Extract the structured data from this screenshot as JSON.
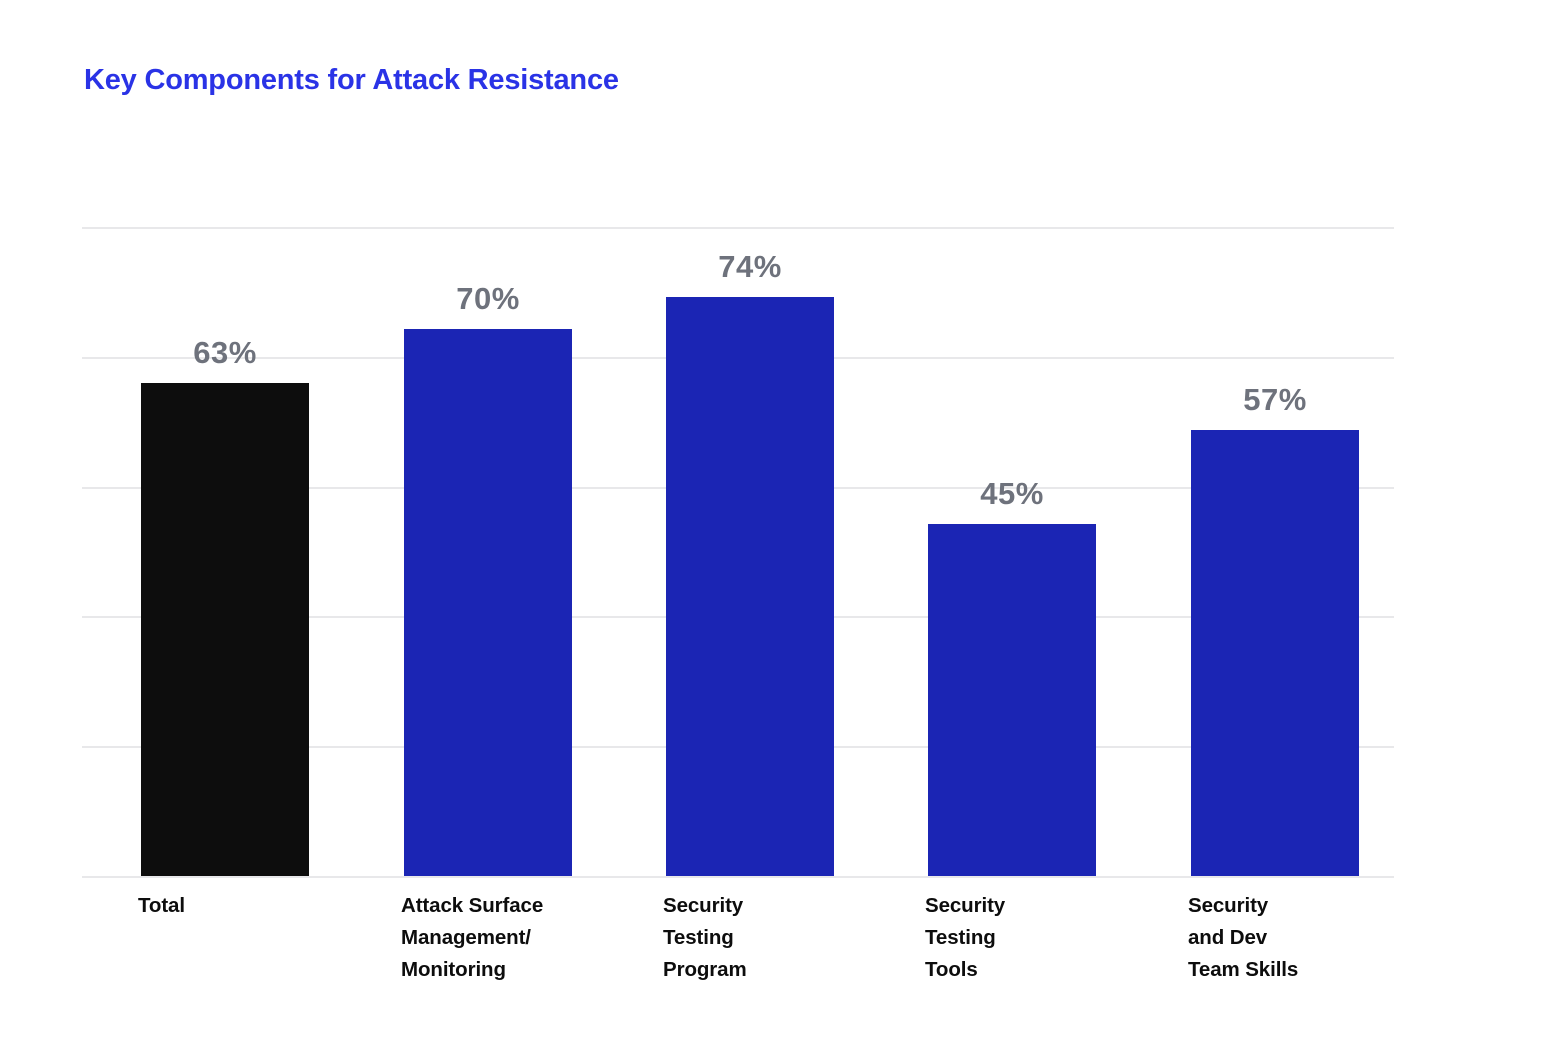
{
  "chart_data": {
    "type": "bar",
    "title": "Key Components for Attack Resistance",
    "xlabel": "",
    "ylabel": "",
    "ylim": [
      0,
      83
    ],
    "grid": true,
    "legend": "none",
    "value_suffix": "%",
    "categories": [
      "Total",
      "Attack Surface Management/ Monitoring",
      "Security Testing Program",
      "Security Testing Tools",
      "Security and Dev Team Skills"
    ],
    "category_lines": [
      [
        "Total"
      ],
      [
        "Attack Surface",
        "Management/",
        "Monitoring"
      ],
      [
        "Security",
        "Testing",
        "Program"
      ],
      [
        "Security",
        "Testing",
        "Tools"
      ],
      [
        "Security",
        "and Dev",
        "Team Skills"
      ]
    ],
    "values": [
      63,
      70,
      74,
      45,
      57
    ],
    "value_labels": [
      "63%",
      "70%",
      "74%",
      "45%",
      "57%"
    ],
    "bar_colors": [
      "#0d0d0d",
      "#1b25b4",
      "#1b25b4",
      "#1b25b4",
      "#1b25b4"
    ],
    "gridline_count": 6
  },
  "colors": {
    "title": "#2a33e6",
    "bar_primary": "#1b25b4",
    "bar_total": "#0d0d0d",
    "value_label": "#6e727c",
    "category_label": "#0d0d0d",
    "gridline": "#e8e8ea",
    "background": "#ffffff"
  }
}
